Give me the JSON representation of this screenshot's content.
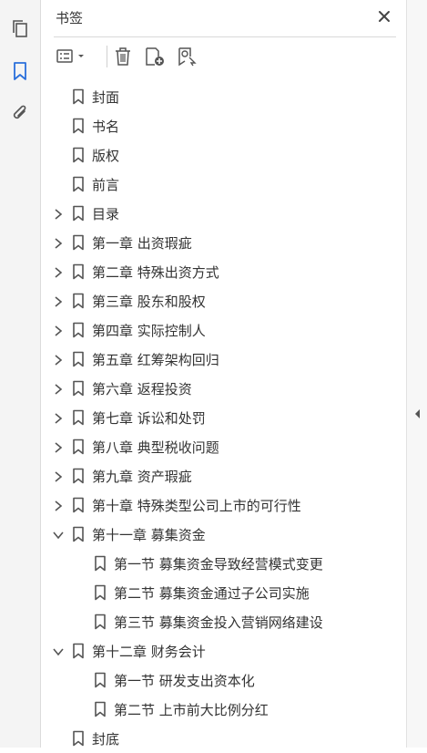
{
  "panel": {
    "title": "书签"
  },
  "bookmarks": [
    {
      "label": "封面",
      "chev": "none",
      "level": 0
    },
    {
      "label": "书名",
      "chev": "none",
      "level": 0
    },
    {
      "label": "版权",
      "chev": "none",
      "level": 0
    },
    {
      "label": "前言",
      "chev": "none",
      "level": 0
    },
    {
      "label": "目录",
      "chev": "right",
      "level": 0
    },
    {
      "label": "第一章  出资瑕疵",
      "chev": "right",
      "level": 0
    },
    {
      "label": "第二章  特殊出资方式",
      "chev": "right",
      "level": 0
    },
    {
      "label": "第三章  股东和股权",
      "chev": "right",
      "level": 0
    },
    {
      "label": "第四章  实际控制人",
      "chev": "right",
      "level": 0
    },
    {
      "label": "第五章  红筹架构回归",
      "chev": "right",
      "level": 0
    },
    {
      "label": "第六章  返程投资",
      "chev": "right",
      "level": 0
    },
    {
      "label": "第七章  诉讼和处罚",
      "chev": "right",
      "level": 0
    },
    {
      "label": "第八章  典型税收问题",
      "chev": "right",
      "level": 0
    },
    {
      "label": "第九章  资产瑕疵",
      "chev": "right",
      "level": 0
    },
    {
      "label": "第十章  特殊类型公司上市的可行性",
      "chev": "right",
      "level": 0
    },
    {
      "label": "第十一章  募集资金",
      "chev": "down",
      "level": 0
    },
    {
      "label": "第一节  募集资金导致经营模式变更",
      "chev": "none",
      "level": 1
    },
    {
      "label": "第二节  募集资金通过子公司实施",
      "chev": "none",
      "level": 1
    },
    {
      "label": "第三节  募集资金投入营销网络建设",
      "chev": "none",
      "level": 1
    },
    {
      "label": "第十二章  财务会计",
      "chev": "down",
      "level": 0
    },
    {
      "label": "第一节  研发支出资本化",
      "chev": "none",
      "level": 1
    },
    {
      "label": "第二节  上市前大比例分红",
      "chev": "none",
      "level": 1
    },
    {
      "label": "封底",
      "chev": "none",
      "level": 0
    }
  ],
  "colors": {
    "icon": "#555555",
    "accent": "#2a6fdb"
  }
}
